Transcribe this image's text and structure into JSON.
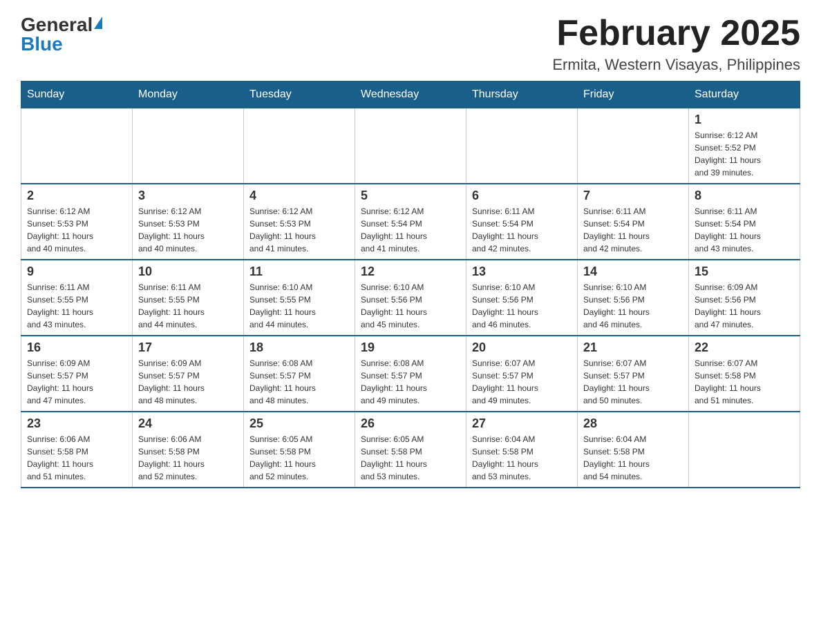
{
  "logo": {
    "general": "General",
    "blue": "Blue"
  },
  "header": {
    "title": "February 2025",
    "subtitle": "Ermita, Western Visayas, Philippines"
  },
  "days_of_week": [
    "Sunday",
    "Monday",
    "Tuesday",
    "Wednesday",
    "Thursday",
    "Friday",
    "Saturday"
  ],
  "weeks": [
    [
      {
        "num": "",
        "info": ""
      },
      {
        "num": "",
        "info": ""
      },
      {
        "num": "",
        "info": ""
      },
      {
        "num": "",
        "info": ""
      },
      {
        "num": "",
        "info": ""
      },
      {
        "num": "",
        "info": ""
      },
      {
        "num": "1",
        "info": "Sunrise: 6:12 AM\nSunset: 5:52 PM\nDaylight: 11 hours\nand 39 minutes."
      }
    ],
    [
      {
        "num": "2",
        "info": "Sunrise: 6:12 AM\nSunset: 5:53 PM\nDaylight: 11 hours\nand 40 minutes."
      },
      {
        "num": "3",
        "info": "Sunrise: 6:12 AM\nSunset: 5:53 PM\nDaylight: 11 hours\nand 40 minutes."
      },
      {
        "num": "4",
        "info": "Sunrise: 6:12 AM\nSunset: 5:53 PM\nDaylight: 11 hours\nand 41 minutes."
      },
      {
        "num": "5",
        "info": "Sunrise: 6:12 AM\nSunset: 5:54 PM\nDaylight: 11 hours\nand 41 minutes."
      },
      {
        "num": "6",
        "info": "Sunrise: 6:11 AM\nSunset: 5:54 PM\nDaylight: 11 hours\nand 42 minutes."
      },
      {
        "num": "7",
        "info": "Sunrise: 6:11 AM\nSunset: 5:54 PM\nDaylight: 11 hours\nand 42 minutes."
      },
      {
        "num": "8",
        "info": "Sunrise: 6:11 AM\nSunset: 5:54 PM\nDaylight: 11 hours\nand 43 minutes."
      }
    ],
    [
      {
        "num": "9",
        "info": "Sunrise: 6:11 AM\nSunset: 5:55 PM\nDaylight: 11 hours\nand 43 minutes."
      },
      {
        "num": "10",
        "info": "Sunrise: 6:11 AM\nSunset: 5:55 PM\nDaylight: 11 hours\nand 44 minutes."
      },
      {
        "num": "11",
        "info": "Sunrise: 6:10 AM\nSunset: 5:55 PM\nDaylight: 11 hours\nand 44 minutes."
      },
      {
        "num": "12",
        "info": "Sunrise: 6:10 AM\nSunset: 5:56 PM\nDaylight: 11 hours\nand 45 minutes."
      },
      {
        "num": "13",
        "info": "Sunrise: 6:10 AM\nSunset: 5:56 PM\nDaylight: 11 hours\nand 46 minutes."
      },
      {
        "num": "14",
        "info": "Sunrise: 6:10 AM\nSunset: 5:56 PM\nDaylight: 11 hours\nand 46 minutes."
      },
      {
        "num": "15",
        "info": "Sunrise: 6:09 AM\nSunset: 5:56 PM\nDaylight: 11 hours\nand 47 minutes."
      }
    ],
    [
      {
        "num": "16",
        "info": "Sunrise: 6:09 AM\nSunset: 5:57 PM\nDaylight: 11 hours\nand 47 minutes."
      },
      {
        "num": "17",
        "info": "Sunrise: 6:09 AM\nSunset: 5:57 PM\nDaylight: 11 hours\nand 48 minutes."
      },
      {
        "num": "18",
        "info": "Sunrise: 6:08 AM\nSunset: 5:57 PM\nDaylight: 11 hours\nand 48 minutes."
      },
      {
        "num": "19",
        "info": "Sunrise: 6:08 AM\nSunset: 5:57 PM\nDaylight: 11 hours\nand 49 minutes."
      },
      {
        "num": "20",
        "info": "Sunrise: 6:07 AM\nSunset: 5:57 PM\nDaylight: 11 hours\nand 49 minutes."
      },
      {
        "num": "21",
        "info": "Sunrise: 6:07 AM\nSunset: 5:57 PM\nDaylight: 11 hours\nand 50 minutes."
      },
      {
        "num": "22",
        "info": "Sunrise: 6:07 AM\nSunset: 5:58 PM\nDaylight: 11 hours\nand 51 minutes."
      }
    ],
    [
      {
        "num": "23",
        "info": "Sunrise: 6:06 AM\nSunset: 5:58 PM\nDaylight: 11 hours\nand 51 minutes."
      },
      {
        "num": "24",
        "info": "Sunrise: 6:06 AM\nSunset: 5:58 PM\nDaylight: 11 hours\nand 52 minutes."
      },
      {
        "num": "25",
        "info": "Sunrise: 6:05 AM\nSunset: 5:58 PM\nDaylight: 11 hours\nand 52 minutes."
      },
      {
        "num": "26",
        "info": "Sunrise: 6:05 AM\nSunset: 5:58 PM\nDaylight: 11 hours\nand 53 minutes."
      },
      {
        "num": "27",
        "info": "Sunrise: 6:04 AM\nSunset: 5:58 PM\nDaylight: 11 hours\nand 53 minutes."
      },
      {
        "num": "28",
        "info": "Sunrise: 6:04 AM\nSunset: 5:58 PM\nDaylight: 11 hours\nand 54 minutes."
      },
      {
        "num": "",
        "info": ""
      }
    ]
  ]
}
